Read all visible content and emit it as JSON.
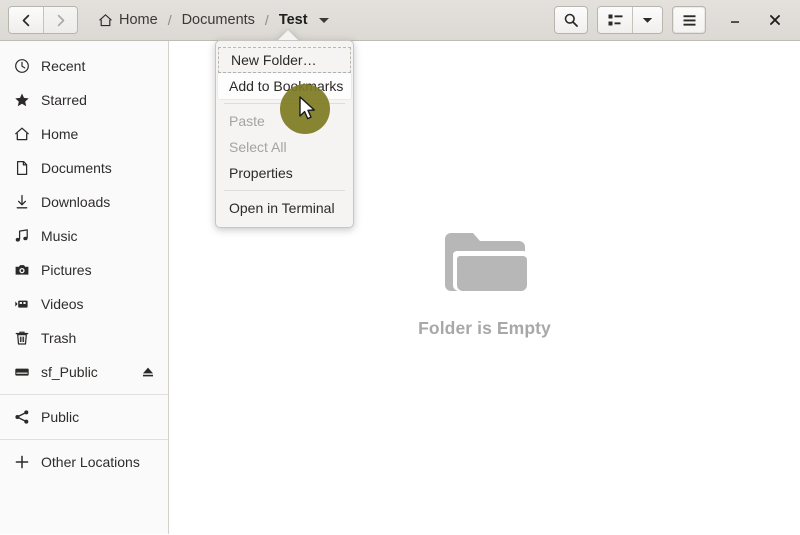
{
  "window": {
    "title": "Test",
    "minimize_label": "Minimize",
    "close_label": "Close"
  },
  "header": {
    "back_label": "Back",
    "forward_label": "Forward",
    "breadcrumbs": [
      {
        "label": "Home",
        "icon": "home-icon",
        "current": false
      },
      {
        "label": "Documents",
        "icon": "",
        "current": false
      },
      {
        "label": "Test",
        "icon": "",
        "current": true
      }
    ],
    "separator": "/",
    "search_label": "Search",
    "view_label": "View options",
    "view_menu_label": "View menu",
    "menu_label": "Main menu"
  },
  "sidebar": {
    "items": [
      {
        "label": "Recent",
        "icon": "clock-icon",
        "eject": false
      },
      {
        "label": "Starred",
        "icon": "star-icon",
        "eject": false
      },
      {
        "label": "Home",
        "icon": "home-icon",
        "eject": false
      },
      {
        "label": "Documents",
        "icon": "document-icon",
        "eject": false
      },
      {
        "label": "Downloads",
        "icon": "download-icon",
        "eject": false
      },
      {
        "label": "Music",
        "icon": "music-icon",
        "eject": false
      },
      {
        "label": "Pictures",
        "icon": "camera-icon",
        "eject": false
      },
      {
        "label": "Videos",
        "icon": "video-icon",
        "eject": false
      },
      {
        "label": "Trash",
        "icon": "trash-icon",
        "eject": false
      },
      {
        "label": "sf_Public",
        "icon": "drive-icon",
        "eject": true
      }
    ],
    "network_items": [
      {
        "label": "Public",
        "icon": "share-icon"
      }
    ],
    "other_items": [
      {
        "label": "Other Locations",
        "icon": "plus-icon"
      }
    ]
  },
  "content": {
    "empty_label": "Folder is Empty",
    "empty_icon": "folder-icon"
  },
  "context_menu": {
    "items": [
      {
        "label": "New Folder…",
        "state": "focused"
      },
      {
        "label": "Add to Bookmarks",
        "state": "hover"
      },
      {
        "label": "sep",
        "state": "separator"
      },
      {
        "label": "Paste",
        "state": "disabled"
      },
      {
        "label": "Select All",
        "state": "disabled"
      },
      {
        "label": "Properties",
        "state": "normal"
      },
      {
        "label": "sep2",
        "state": "separator"
      },
      {
        "label": "Open in Terminal",
        "state": "normal"
      }
    ]
  },
  "colors": {
    "headerbar": "#dfdcd8",
    "sidebar": "#fbfafa",
    "content": "#ffffff",
    "menu": "#f5f4f2",
    "cursor_highlight": "#7d7a22",
    "empty_text": "#a8a8a8",
    "folder_icon": "#b7b7b7"
  }
}
